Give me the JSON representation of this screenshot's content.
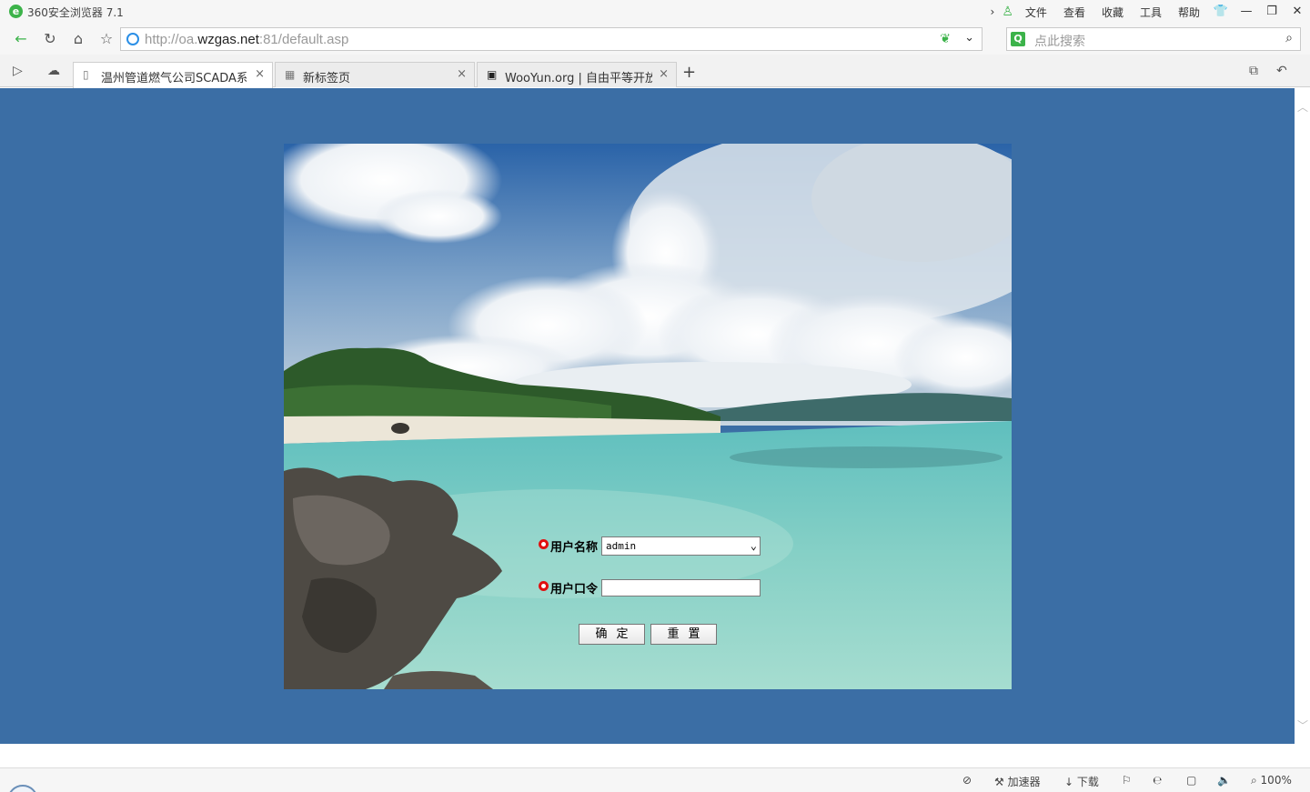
{
  "titlebar": {
    "app_title": "360安全浏览器 7.1",
    "menu": [
      "文件",
      "查看",
      "收藏",
      "工具",
      "帮助"
    ]
  },
  "addressbar": {
    "url_prefix": "http://oa.",
    "url_domain": "wzgas.net",
    "url_suffix": ":81/default.asp",
    "search_placeholder": "点此搜索"
  },
  "tabs": [
    {
      "label": "温州管道燃气公司SCADA系统",
      "active": true
    },
    {
      "label": "新标签页",
      "active": false
    },
    {
      "label": "WooYun.org | 自由平等开放的",
      "active": false
    }
  ],
  "login": {
    "username_label": "用户名称",
    "username_value": "admin",
    "password_label": "用户口令",
    "submit_label": "确定",
    "reset_label": "重置"
  },
  "statusbar": {
    "accelerator": "加速器",
    "download": "下载",
    "zoom": "100%"
  },
  "colors": {
    "page_background": "#3b6ea5",
    "accent_green": "#3cb34a",
    "required_dot": "#e01010"
  }
}
